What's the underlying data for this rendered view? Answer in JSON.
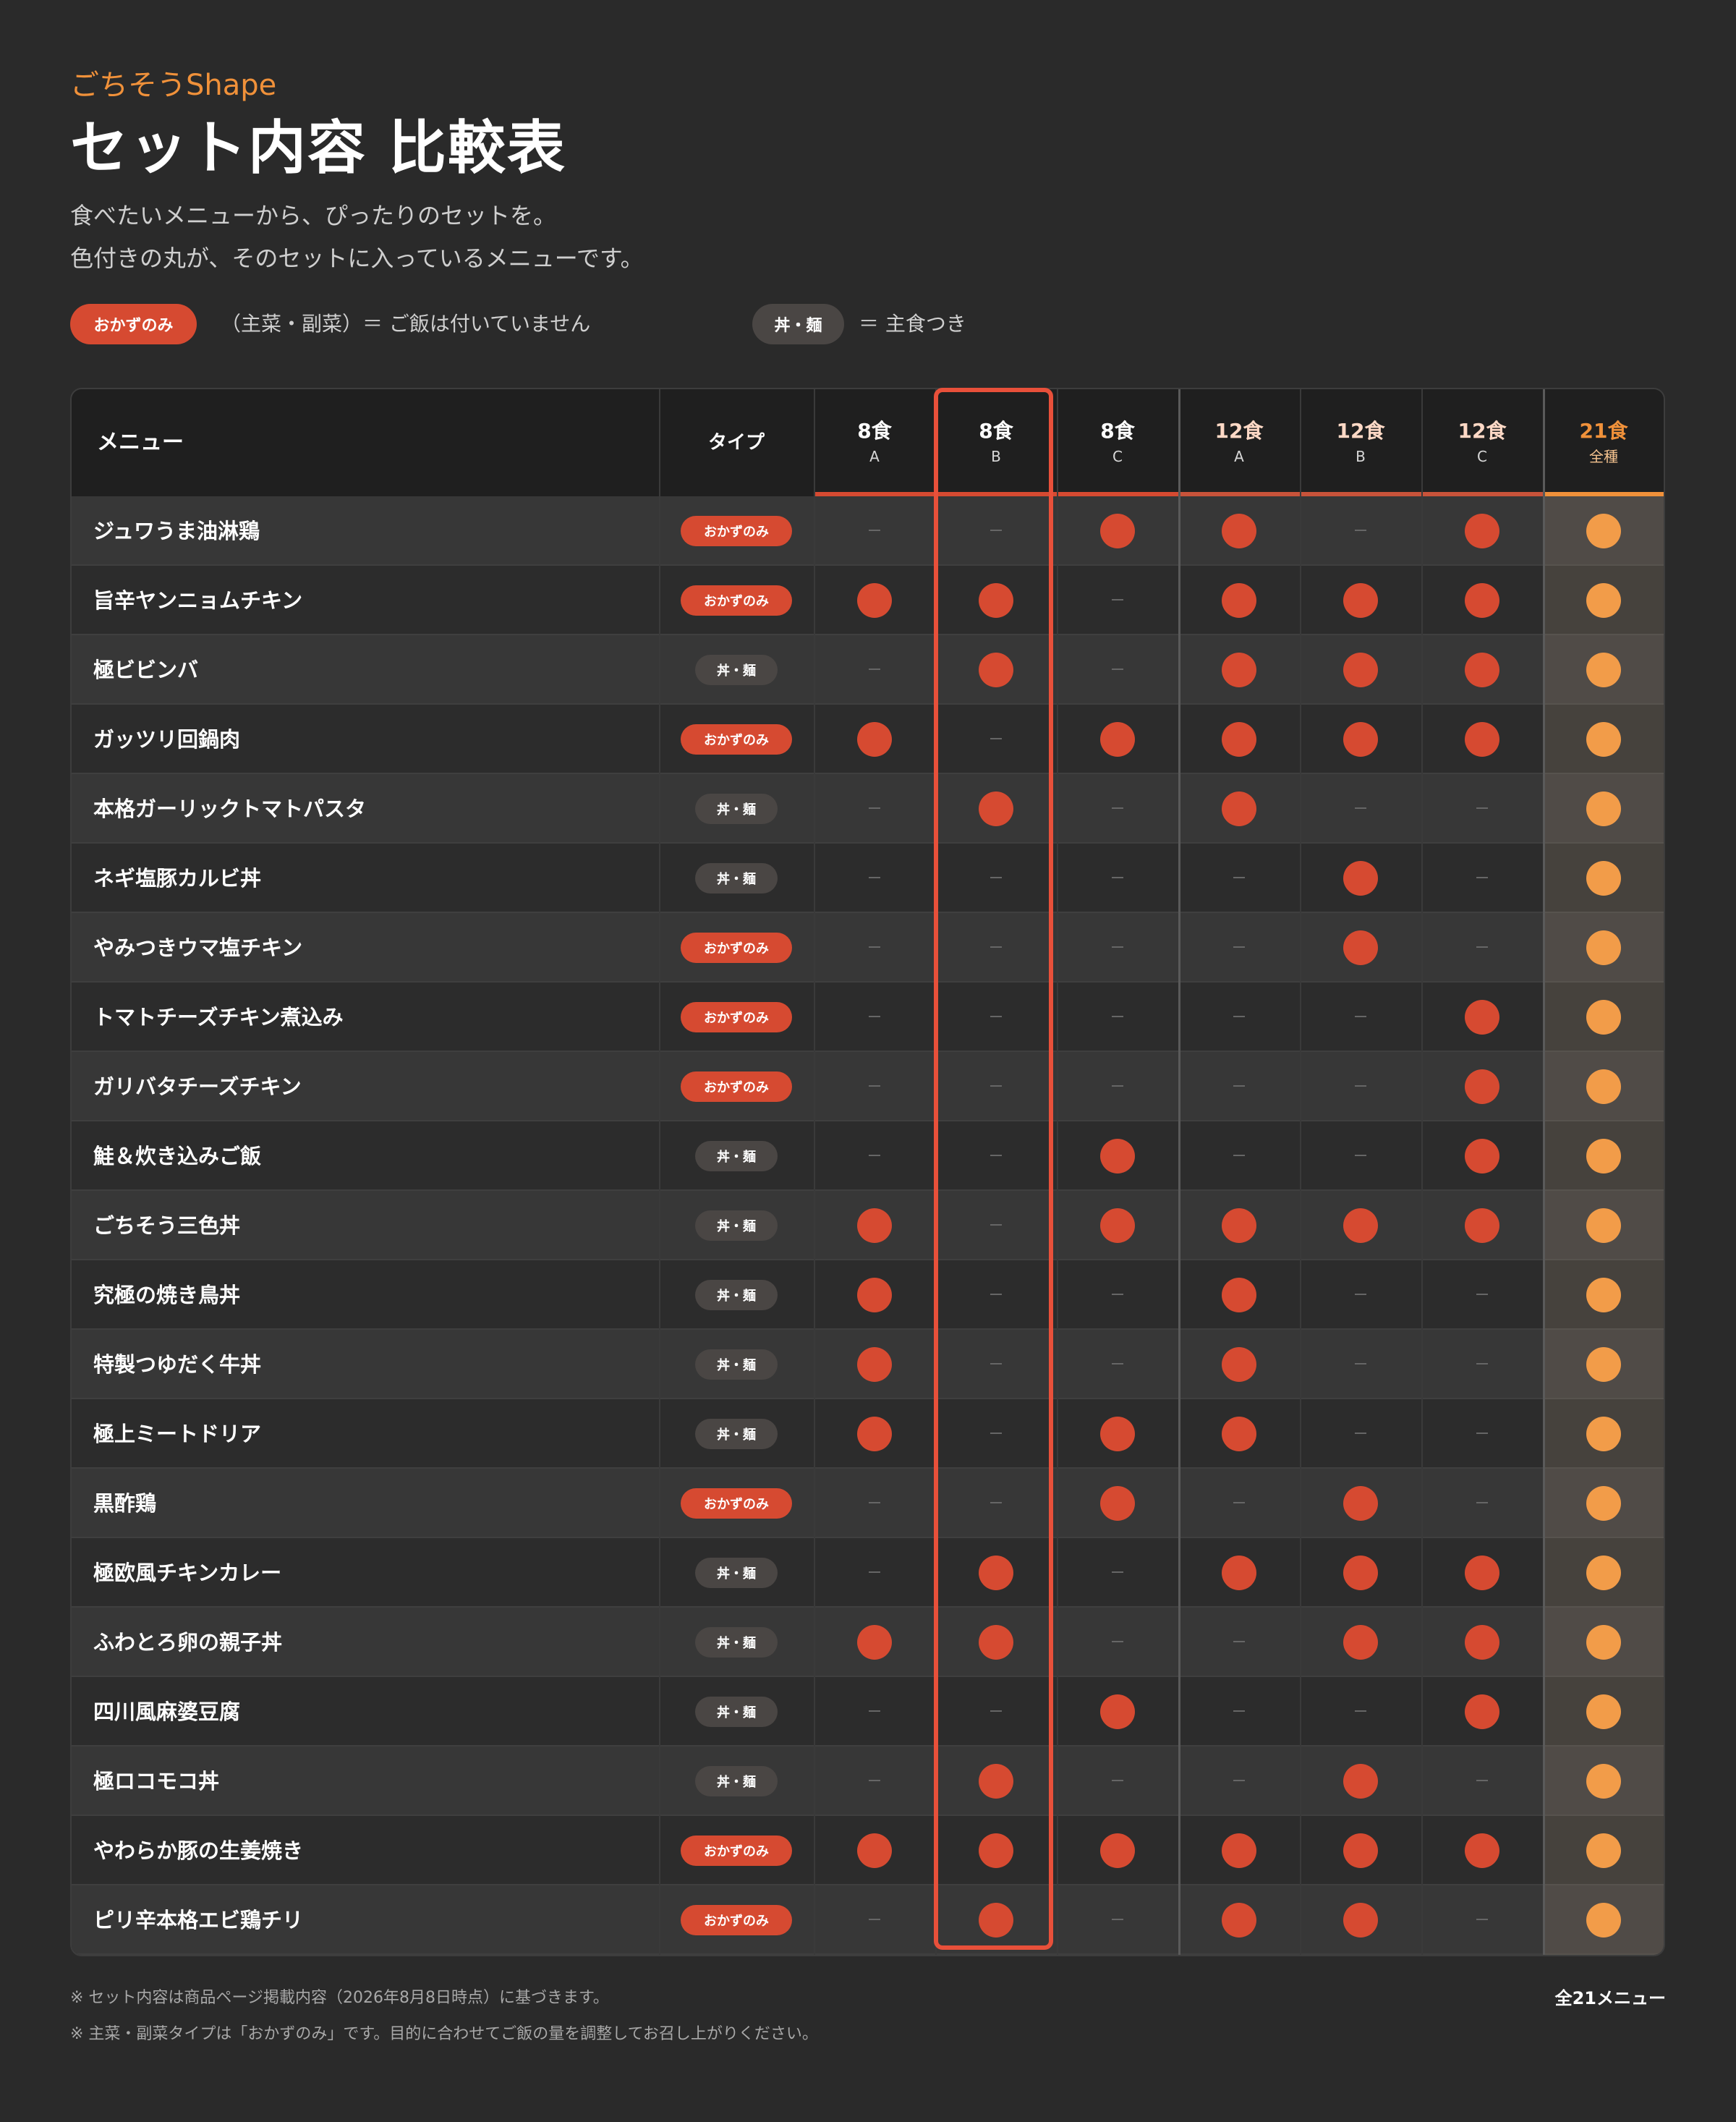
{
  "header": {
    "brand": "ごちそうShape",
    "title": "セット内容 比較表",
    "description_line1": "食べたいメニューから、ぴったりのセットを。",
    "description_line2": "色付きの丸が、そのセットに入っているメニューです。"
  },
  "legend": {
    "okazu_label": "おかずのみ",
    "okazu_text": "（主菜・副菜）＝ ご飯は付いていません",
    "don_label": "丼・麺",
    "don_text": "＝ 主食つき"
  },
  "table": {
    "menu_header": "メニュー",
    "type_header": "タイプ",
    "sets": [
      {
        "name": "8食",
        "variant": "A"
      },
      {
        "name": "8食",
        "variant": "B"
      },
      {
        "name": "8食",
        "variant": "C"
      },
      {
        "name": "12食",
        "variant": "A"
      },
      {
        "name": "12食",
        "variant": "B"
      },
      {
        "name": "12食",
        "variant": "C"
      },
      {
        "name": "21食",
        "variant": "全種"
      }
    ],
    "highlighted_set": "8食 B",
    "rows": [
      {
        "menu": "ジュワうま油淋鶏",
        "type": "おかずのみ",
        "included": [
          0,
          0,
          1,
          1,
          0,
          1,
          1
        ]
      },
      {
        "menu": "旨辛ヤンニョムチキン",
        "type": "おかずのみ",
        "included": [
          1,
          1,
          0,
          1,
          1,
          1,
          1
        ]
      },
      {
        "menu": "極ビビンバ",
        "type": "丼・麺",
        "included": [
          0,
          1,
          0,
          1,
          1,
          1,
          1
        ]
      },
      {
        "menu": "ガッツリ回鍋肉",
        "type": "おかずのみ",
        "included": [
          1,
          0,
          1,
          1,
          1,
          1,
          1
        ]
      },
      {
        "menu": "本格ガーリックトマトパスタ",
        "type": "丼・麺",
        "included": [
          0,
          1,
          0,
          1,
          0,
          0,
          1
        ]
      },
      {
        "menu": "ネギ塩豚カルビ丼",
        "type": "丼・麺",
        "included": [
          0,
          0,
          0,
          0,
          1,
          0,
          1
        ]
      },
      {
        "menu": "やみつきウマ塩チキン",
        "type": "おかずのみ",
        "included": [
          0,
          0,
          0,
          0,
          1,
          0,
          1
        ]
      },
      {
        "menu": "トマトチーズチキン煮込み",
        "type": "おかずのみ",
        "included": [
          0,
          0,
          0,
          0,
          0,
          1,
          1
        ]
      },
      {
        "menu": "ガリバタチーズチキン",
        "type": "おかずのみ",
        "included": [
          0,
          0,
          0,
          0,
          0,
          1,
          1
        ]
      },
      {
        "menu": "鮭＆炊き込みご飯",
        "type": "丼・麺",
        "included": [
          0,
          0,
          1,
          0,
          0,
          1,
          1
        ]
      },
      {
        "menu": "ごちそう三色丼",
        "type": "丼・麺",
        "included": [
          1,
          0,
          1,
          1,
          1,
          1,
          1
        ]
      },
      {
        "menu": "究極の焼き鳥丼",
        "type": "丼・麺",
        "included": [
          1,
          0,
          0,
          1,
          0,
          0,
          1
        ]
      },
      {
        "menu": "特製つゆだく牛丼",
        "type": "丼・麺",
        "included": [
          1,
          0,
          0,
          1,
          0,
          0,
          1
        ]
      },
      {
        "menu": "極上ミートドリア",
        "type": "丼・麺",
        "included": [
          1,
          0,
          1,
          1,
          0,
          0,
          1
        ]
      },
      {
        "menu": "黒酢鶏",
        "type": "おかずのみ",
        "included": [
          0,
          0,
          1,
          0,
          1,
          0,
          1
        ]
      },
      {
        "menu": "極欧風チキンカレー",
        "type": "丼・麺",
        "included": [
          0,
          1,
          0,
          1,
          1,
          1,
          1
        ]
      },
      {
        "menu": "ふわとろ卵の親子丼",
        "type": "丼・麺",
        "included": [
          1,
          1,
          0,
          0,
          1,
          1,
          1
        ]
      },
      {
        "menu": "四川風麻婆豆腐",
        "type": "丼・麺",
        "included": [
          0,
          0,
          1,
          0,
          0,
          1,
          1
        ]
      },
      {
        "menu": "極ロコモコ丼",
        "type": "丼・麺",
        "included": [
          0,
          1,
          0,
          0,
          1,
          0,
          1
        ]
      },
      {
        "menu": "やわらか豚の生姜焼き",
        "type": "おかずのみ",
        "included": [
          1,
          1,
          1,
          1,
          1,
          1,
          1
        ]
      },
      {
        "menu": "ピリ辛本格エビ鶏チリ",
        "type": "おかずのみ",
        "included": [
          0,
          1,
          0,
          1,
          1,
          0,
          1
        ]
      }
    ]
  },
  "footer": {
    "note1": "※ セット内容は商品ページ掲載内容（2026年8月8日時点）に基づきます。",
    "note2": "※ 主菜・副菜タイプは「おかずのみ」です。目的に合わせてご飯の量を調整してお召し上がりください。",
    "total": "全21メニュー"
  },
  "colors": {
    "background": "#2a2a2a",
    "accent_red": "#d64a31",
    "accent_orange": "#f0913a",
    "highlight_border": "#e8503a"
  }
}
